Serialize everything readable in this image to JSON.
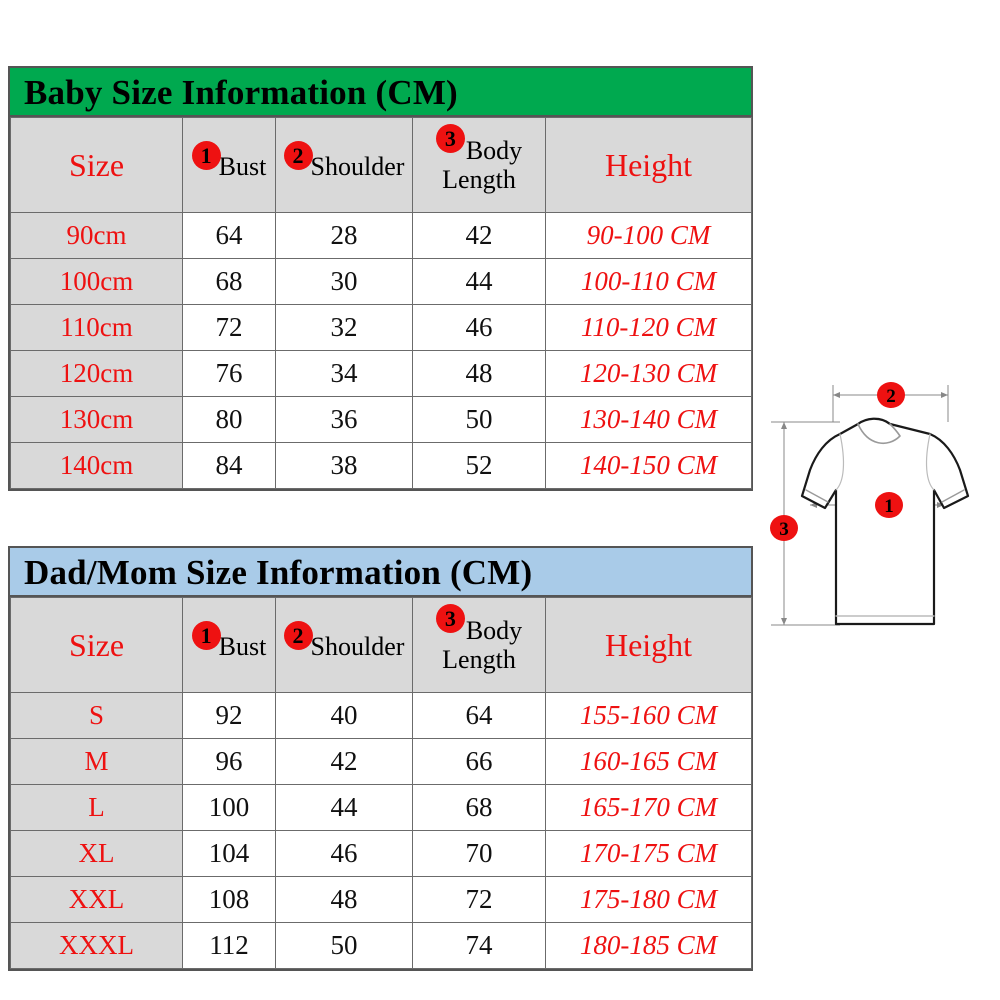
{
  "tables": [
    {
      "id": "baby",
      "title": "Baby  Size Information (CM)",
      "title_bg": "#00a94f",
      "headers": {
        "size": "Size",
        "bust": "Bust",
        "shoulder": "Shoulder",
        "body_length_line1": "Body",
        "body_length_line2": "Length",
        "height": "Height"
      },
      "badges": {
        "bust": "1",
        "shoulder": "2",
        "body_length": "3"
      },
      "rows": [
        {
          "size": "90cm",
          "bust": "64",
          "shoulder": "28",
          "body_length": "42",
          "height": "90-100 CM"
        },
        {
          "size": "100cm",
          "bust": "68",
          "shoulder": "30",
          "body_length": "44",
          "height": "100-110 CM"
        },
        {
          "size": "110cm",
          "bust": "72",
          "shoulder": "32",
          "body_length": "46",
          "height": "110-120 CM"
        },
        {
          "size": "120cm",
          "bust": "76",
          "shoulder": "34",
          "body_length": "48",
          "height": "120-130 CM"
        },
        {
          "size": "130cm",
          "bust": "80",
          "shoulder": "36",
          "body_length": "50",
          "height": "130-140 CM"
        },
        {
          "size": "140cm",
          "bust": "84",
          "shoulder": "38",
          "body_length": "52",
          "height": "140-150 CM"
        }
      ]
    },
    {
      "id": "adult",
      "title": "Dad/Mom  Size Information (CM)",
      "title_bg": "#a9cbe8",
      "headers": {
        "size": "Size",
        "bust": "Bust",
        "shoulder": "Shoulder",
        "body_length_line1": "Body",
        "body_length_line2": "Length",
        "height": "Height"
      },
      "badges": {
        "bust": "1",
        "shoulder": "2",
        "body_length": "3"
      },
      "rows": [
        {
          "size": "S",
          "bust": "92",
          "shoulder": "40",
          "body_length": "64",
          "height": "155-160 CM"
        },
        {
          "size": "M",
          "bust": "96",
          "shoulder": "42",
          "body_length": "66",
          "height": "160-165 CM"
        },
        {
          "size": "L",
          "bust": "100",
          "shoulder": "44",
          "body_length": "68",
          "height": "165-170 CM"
        },
        {
          "size": "XL",
          "bust": "104",
          "shoulder": "46",
          "body_length": "70",
          "height": "170-175 CM"
        },
        {
          "size": "XXL",
          "bust": "108",
          "shoulder": "48",
          "body_length": "72",
          "height": "175-180 CM"
        },
        {
          "size": "XXXL",
          "bust": "112",
          "shoulder": "50",
          "body_length": "74",
          "height": "180-185 CM"
        }
      ]
    }
  ],
  "diagram": {
    "name": "tshirt-measurement-diagram",
    "markers": {
      "shoulder": "2",
      "bust": "1",
      "body_length": "3"
    }
  },
  "colors": {
    "red": "#ee1111",
    "green_header": "#00a94f",
    "blue_header": "#a9cbe8",
    "cell_gray": "#d9d9d9",
    "border": "#6b6b6b"
  }
}
